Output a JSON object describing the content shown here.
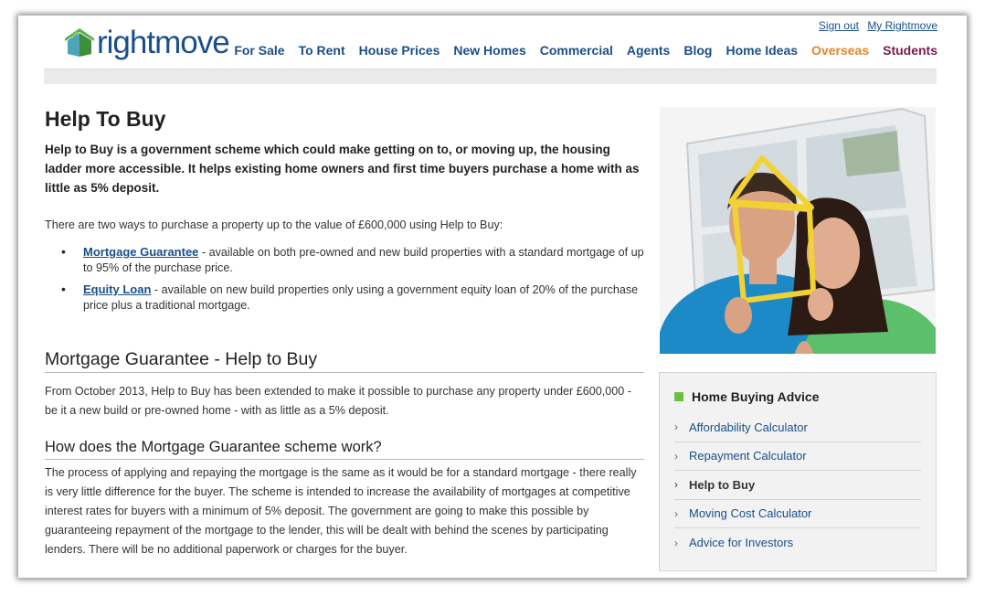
{
  "header": {
    "logo_text": "rightmove",
    "sign_out": "Sign out",
    "my_rightmove": "My Rightmove",
    "nav": [
      "For Sale",
      "To Rent",
      "House Prices",
      "New Homes",
      "Commercial",
      "Agents",
      "Blog",
      "Home Ideas",
      "Overseas",
      "Students"
    ]
  },
  "main": {
    "title": "Help To Buy",
    "intro": "Help to Buy is a government scheme which could make getting on to, or moving up, the housing ladder more accessible. It helps existing home owners and first time buyers purchase a home with as little as 5% deposit.",
    "ways_intro": "There are two ways to purchase a property up to the value of £600,000 using Help to Buy:",
    "ways": [
      {
        "link": "Mortgage Guarantee",
        "text": " - available on both pre-owned and new build properties with a standard mortgage of up to 95% of the purchase price."
      },
      {
        "link": "Equity Loan",
        "text": " - available on new build properties only using a government equity loan of 20% of the purchase price plus a traditional mortgage."
      }
    ],
    "section_title": "Mortgage Guarantee - Help to Buy",
    "section_text": "From October 2013, Help to Buy has been extended to make it possible to purchase any property under £600,000 - be it a new build or pre-owned home - with as little as a 5% deposit.",
    "subsection_title": "How does the Mortgage Guarantee scheme work?",
    "subsection_text": "The process of applying and repaying the mortgage is the same as it would be for a standard mortgage - there really is very little difference for the buyer. The scheme is intended to increase the availability of mortgages at competitive interest rates for buyers with a minimum of 5% deposit. The government are going to make this possible by guaranteeing repayment of the mortgage to the lender, this will be dealt with behind the scenes by participating lenders. There will be no additional paperwork or charges for the buyer."
  },
  "sidebar": {
    "advice_title": "Home Buying Advice",
    "links": [
      "Affordability Calculator",
      "Repayment Calculator",
      "Help to Buy",
      "Moving Cost Calculator",
      "Advice for Investors"
    ],
    "active_index": 2
  },
  "colors": {
    "brand_blue": "#1a4f8a",
    "overseas": "#e48426",
    "students": "#7a1a4f",
    "accent_green": "#6cbf3e"
  }
}
